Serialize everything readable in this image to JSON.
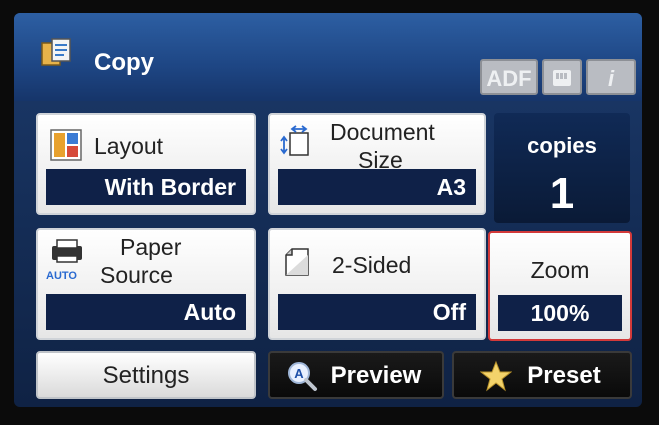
{
  "header": {
    "title": "Copy",
    "status_icons": [
      "ADF",
      "memory-card",
      "info"
    ]
  },
  "copies": {
    "label": "copies",
    "count": "1"
  },
  "tiles": {
    "layout": {
      "label": "Layout",
      "value": "With Border"
    },
    "document_size": {
      "label_line1": "Document",
      "label_line2": "Size",
      "value": "A3"
    },
    "paper_source": {
      "label_line1": "Paper",
      "label_line2": "Source",
      "auto_badge": "AUTO",
      "value": "Auto"
    },
    "two_sided": {
      "label": "2-Sided",
      "value": "Off"
    },
    "zoom": {
      "label": "Zoom",
      "value": "100%"
    }
  },
  "bottom_buttons": {
    "settings": "Settings",
    "preview": "Preview",
    "preset": "Preset"
  },
  "colors": {
    "accent_dark_blue": "#0f2148",
    "header_blue": "#2d5fa3",
    "zoom_border": "#d33a3a"
  }
}
